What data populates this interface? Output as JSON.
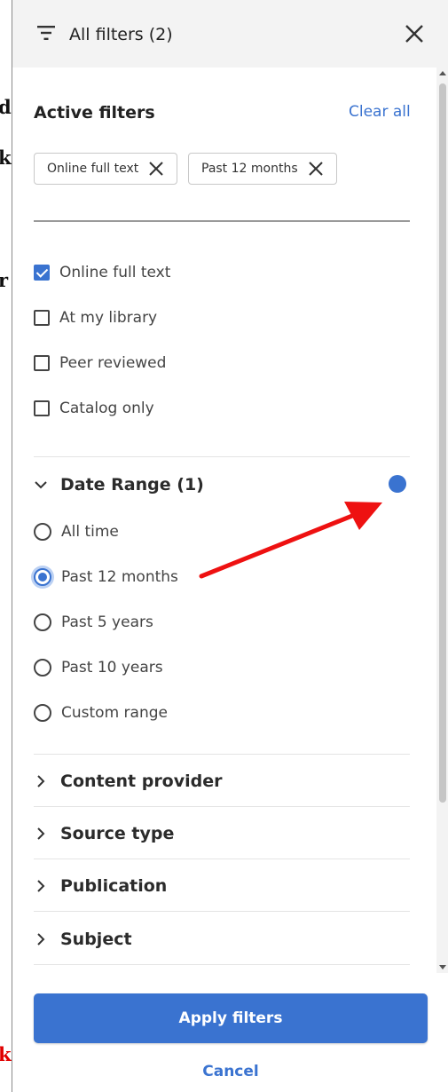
{
  "page_fragments": [
    {
      "text": "d",
      "color": "#111111"
    },
    {
      "text": "k",
      "color": "#111111"
    },
    {
      "text": "r",
      "color": "#111111"
    },
    {
      "text": "k",
      "color": "#e00000"
    }
  ],
  "header": {
    "title": "All filters (2)",
    "icon": "filter-icon",
    "close_icon": "close-icon"
  },
  "active_filters": {
    "title": "Active filters",
    "clear_all_label": "Clear all",
    "chips": [
      {
        "label": "Online full text"
      },
      {
        "label": "Past 12 months"
      }
    ]
  },
  "checkbox_options": [
    {
      "label": "Online full text",
      "checked": true
    },
    {
      "label": "At my library",
      "checked": false
    },
    {
      "label": "Peer reviewed",
      "checked": false
    },
    {
      "label": "Catalog only",
      "checked": false
    }
  ],
  "date_range": {
    "label": "Date Range (1)",
    "expanded": true,
    "options": [
      {
        "label": "All time",
        "selected": false
      },
      {
        "label": "Past 12 months",
        "selected": true
      },
      {
        "label": "Past 5 years",
        "selected": false
      },
      {
        "label": "Past 10 years",
        "selected": false
      },
      {
        "label": "Custom range",
        "selected": false
      }
    ]
  },
  "collapsed_groups": [
    {
      "label": "Content provider"
    },
    {
      "label": "Source type"
    },
    {
      "label": "Publication"
    },
    {
      "label": "Subject"
    }
  ],
  "footer": {
    "apply_label": "Apply filters",
    "cancel_label": "Cancel"
  },
  "colors": {
    "accent": "#3a73d0",
    "annotation_arrow": "#ee1111",
    "header_bg": "#f3f3f3"
  }
}
